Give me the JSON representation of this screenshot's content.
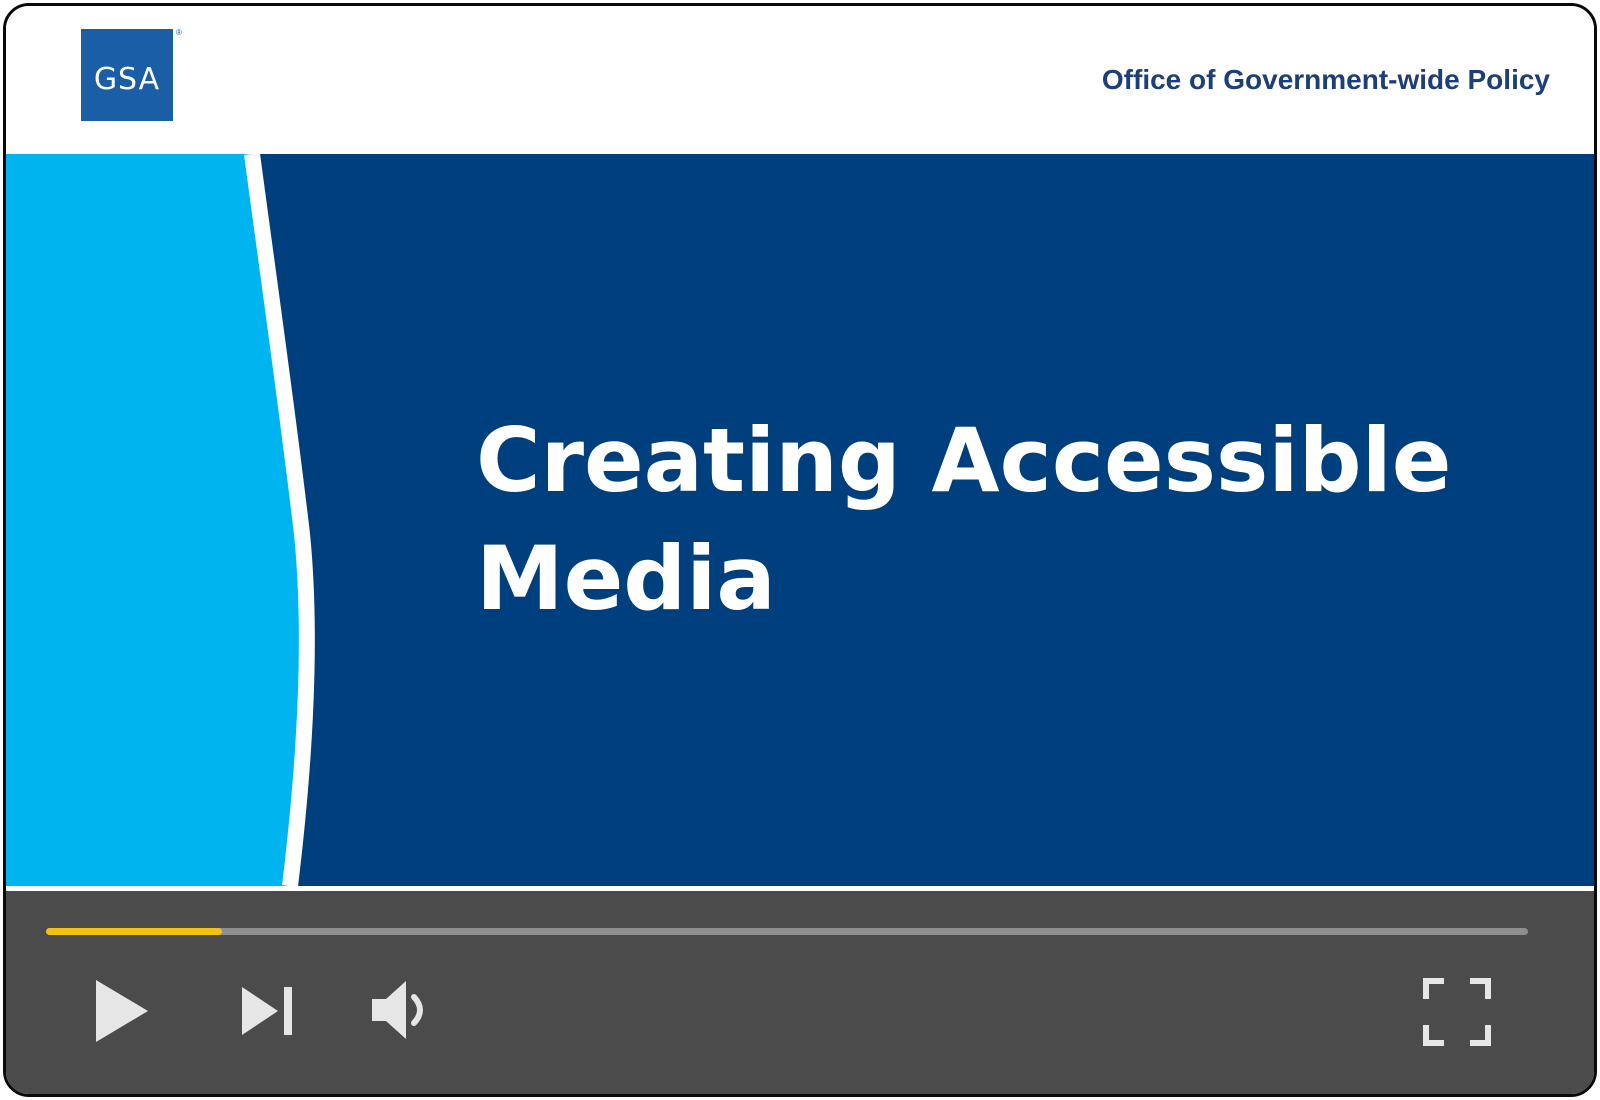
{
  "header": {
    "logo_text": "GSA",
    "logo_reg": "®",
    "office_title": "Office of Government-wide Policy"
  },
  "slide": {
    "title_line1": "Creating Accessible",
    "title_line2": "Media"
  },
  "player": {
    "progress_fraction": 0.119,
    "icons": {
      "play": "play-icon",
      "next": "skip-next-icon",
      "volume": "volume-icon",
      "fullscreen": "fullscreen-icon"
    }
  },
  "colors": {
    "brand_blue": "#1a5ea6",
    "slide_navy": "#003f7d",
    "wave_cyan": "#00b5ef",
    "progress_yellow": "#f4c20d",
    "control_bar": "#4b4b4b",
    "office_text": "#1c3f78"
  }
}
